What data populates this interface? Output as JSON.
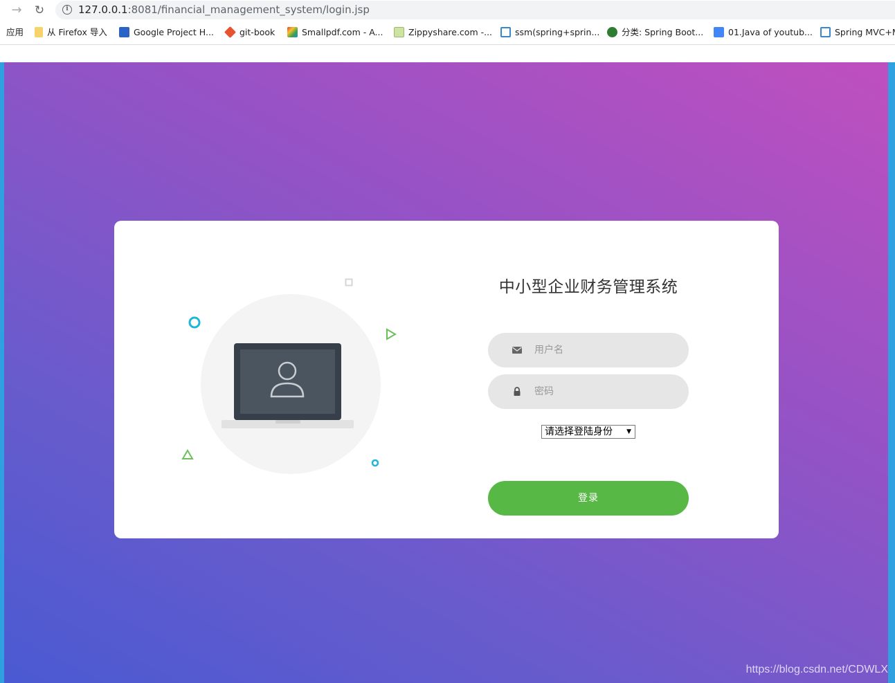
{
  "browser": {
    "url_host": "127.0.0.1",
    "url_rest": ":8081/financial_management_system/login.jsp",
    "bookmarks": [
      {
        "label": "应用",
        "icon": "apps-icon"
      },
      {
        "label": "从 Firefox 导入",
        "icon": "folder-icon"
      },
      {
        "label": "Google Project H...",
        "icon": "google-project-icon"
      },
      {
        "label": "git-book",
        "icon": "git-icon"
      },
      {
        "label": "Smallpdf.com - A...",
        "icon": "smallpdf-icon"
      },
      {
        "label": "Zippyshare.com -...",
        "icon": "zippyshare-icon"
      },
      {
        "label": "ssm(spring+sprin...",
        "icon": "csdn-icon"
      },
      {
        "label": "分类: Spring Boot...",
        "icon": "avatar-icon"
      },
      {
        "label": "01.Java of youtub...",
        "icon": "doc-icon"
      },
      {
        "label": "Spring MVC+M",
        "icon": "csdn-icon"
      }
    ]
  },
  "login": {
    "title": "中小型企业财务管理系统",
    "username_placeholder": "用户名",
    "password_placeholder": "密码",
    "role_select_value": "请选择登陆身份",
    "login_button": "登录"
  },
  "watermark": "https://blog.csdn.net/CDWLX",
  "colors": {
    "login_button": "#57b846",
    "input_bg": "#e6e6e6",
    "gradient_start": "#4a5ad2",
    "gradient_end": "#c04fbf"
  }
}
